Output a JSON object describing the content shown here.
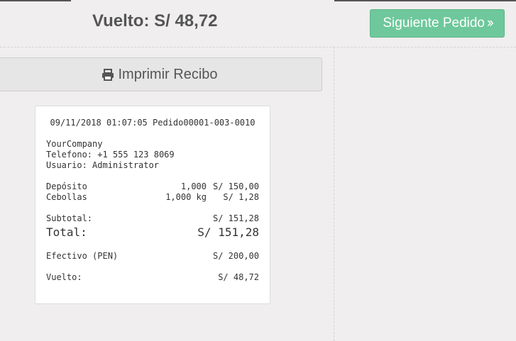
{
  "header": {
    "change_label": "Vuelto: S/ 48,72",
    "next_order_label": "Siguiente Pedido",
    "next_order_icon": "double-chevron-right-icon",
    "accent_color": "#6ec89b"
  },
  "print": {
    "label": "Imprimir Recibo",
    "icon": "printer-icon"
  },
  "receipt": {
    "header_line": "09/11/2018 01:07:05 Pedido00001-003-0010",
    "company": "YourCompany",
    "phone": "Telefono: +1 555 123 8069",
    "user": "Usuario: Administrator",
    "lines": [
      {
        "name": "Depósito",
        "qty": "1,000",
        "price": "S/ 150,00"
      },
      {
        "name": "Cebollas",
        "qty": "1,000 kg",
        "price": "S/ 1,28"
      }
    ],
    "subtotal_label": "Subtotal:",
    "subtotal_value": "S/ 151,28",
    "total_label": "Total:",
    "total_value": "S/ 151,28",
    "payment_label": "Efectivo (PEN)",
    "payment_value": "S/ 200,00",
    "change_label": "Vuelto:",
    "change_value": "S/ 48,72"
  }
}
